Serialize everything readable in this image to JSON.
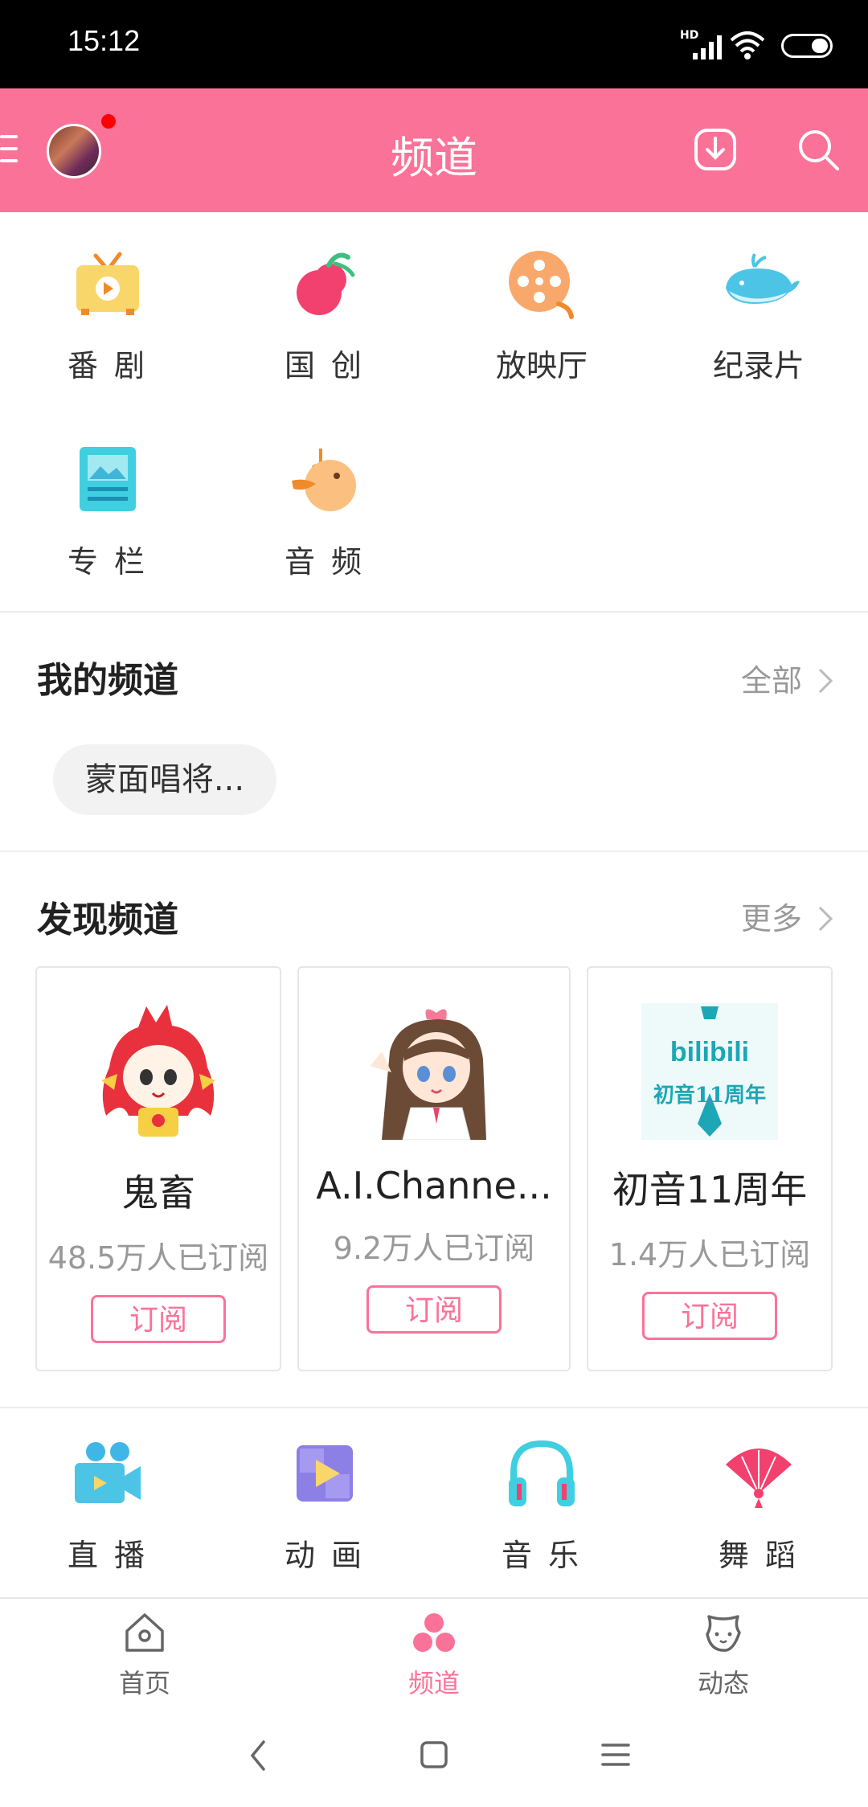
{
  "status_bar": {
    "time": "15:12",
    "network": "HD"
  },
  "header": {
    "title": "频道"
  },
  "top_grid": [
    {
      "label": "番 剧",
      "icon": "tv-icon"
    },
    {
      "label": "国 创",
      "icon": "peach-icon"
    },
    {
      "label": "放映厅",
      "icon": "film-reel-icon"
    },
    {
      "label": "纪录片",
      "icon": "whale-icon"
    },
    {
      "label": "专 栏",
      "icon": "article-icon"
    },
    {
      "label": "音 频",
      "icon": "bird-music-icon"
    }
  ],
  "my_channels": {
    "title": "我的频道",
    "more": "全部",
    "chips": [
      "蒙面唱将..."
    ]
  },
  "discover": {
    "title": "发现频道",
    "more": "更多",
    "cards": [
      {
        "name": "鬼畜",
        "subs": "48.5万人已订阅",
        "button": "订阅"
      },
      {
        "name": "A.I.Channe...",
        "subs": "9.2万人已订阅",
        "button": "订阅"
      },
      {
        "name": "初音11周年",
        "subs": "1.4万人已订阅",
        "button": "订阅",
        "logo_text": "bilibili",
        "logo_sub": "初音11周年"
      }
    ]
  },
  "bottom_grid": [
    {
      "label": "直 播",
      "icon": "camera-icon"
    },
    {
      "label": "动 画",
      "icon": "play-puzzle-icon"
    },
    {
      "label": "音 乐",
      "icon": "headphones-icon"
    },
    {
      "label": "舞 蹈",
      "icon": "fan-icon"
    }
  ],
  "bottom_nav": [
    {
      "label": "首页",
      "active": false
    },
    {
      "label": "频道",
      "active": true
    },
    {
      "label": "动态",
      "active": false
    }
  ],
  "colors": {
    "brand": "#fb7299",
    "active_tab": "#fb7299",
    "inactive_tab": "#666666"
  }
}
